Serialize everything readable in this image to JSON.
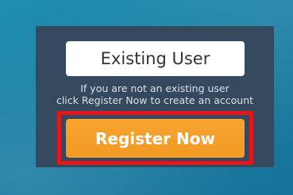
{
  "login_panel": {
    "existing_user_label": "Existing User",
    "hint_line_1": "If you are not an existing user",
    "hint_line_2": "click Register Now to create an account",
    "register_label": "Register Now"
  },
  "colors": {
    "background": "#1b7fa3",
    "panel": "#34495e",
    "register_button": "#f4a02b",
    "highlight_outline": "#e3161b"
  }
}
